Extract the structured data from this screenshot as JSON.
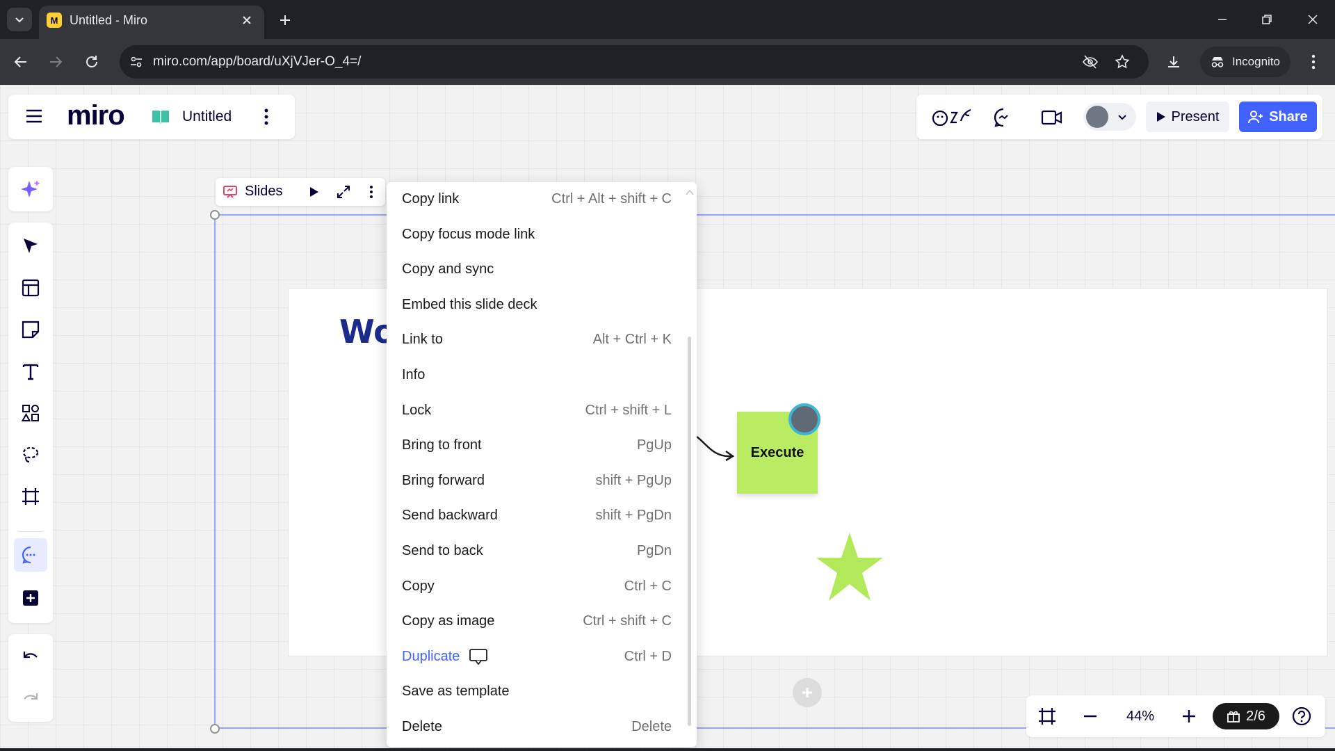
{
  "browser": {
    "tab_title": "Untitled - Miro",
    "favicon_letter": "M",
    "url": "miro.com/app/board/uXjVJer-O_4=/",
    "incognito_label": "Incognito"
  },
  "board": {
    "logo": "miro",
    "title": "Untitled",
    "present_label": "Present",
    "share_label": "Share"
  },
  "frame_toolbar": {
    "label": "Slides"
  },
  "canvas": {
    "slide_heading_fragment": "Wo",
    "sticky_note_text": "Execute",
    "sticky_color": "#b9ec62",
    "star_color": "#b2e85a"
  },
  "context_menu": {
    "items": [
      {
        "label": "Copy link",
        "shortcut": "Ctrl + Alt + shift + C"
      },
      {
        "label": "Copy focus mode link",
        "shortcut": ""
      },
      {
        "label": "Copy and sync",
        "shortcut": ""
      },
      {
        "label": "Embed this slide deck",
        "shortcut": ""
      },
      {
        "label": "Link to",
        "shortcut": "Alt + Ctrl + K"
      },
      {
        "label": "Info",
        "shortcut": ""
      },
      {
        "label": "Lock",
        "shortcut": "Ctrl + shift + L"
      },
      {
        "label": "Bring to front",
        "shortcut": "PgUp"
      },
      {
        "label": "Bring forward",
        "shortcut": "shift + PgUp"
      },
      {
        "label": "Send backward",
        "shortcut": "shift + PgDn"
      },
      {
        "label": "Send to back",
        "shortcut": "PgDn"
      },
      {
        "label": "Copy",
        "shortcut": "Ctrl + C"
      },
      {
        "label": "Copy as image",
        "shortcut": "Ctrl + shift + C"
      },
      {
        "label": "Duplicate",
        "shortcut": "Ctrl + D"
      },
      {
        "label": "Save as template",
        "shortcut": ""
      },
      {
        "label": "Delete",
        "shortcut": "Delete"
      }
    ]
  },
  "zoom": {
    "level": "44%",
    "slide_counter": "2/6"
  },
  "colors": {
    "accent": "#4262ff",
    "frame_outline": "#98a4f5"
  }
}
